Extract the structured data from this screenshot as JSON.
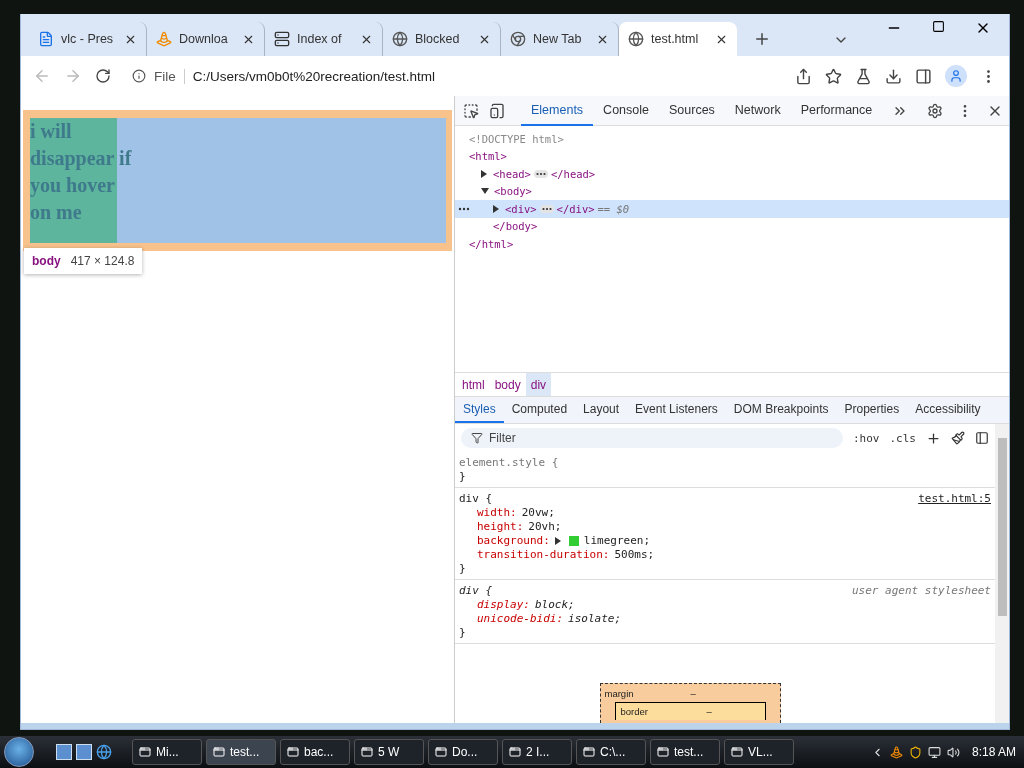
{
  "browser": {
    "tabs": [
      {
        "title": "vlc - Pres",
        "selected": false
      },
      {
        "title": "Downloa",
        "selected": false
      },
      {
        "title": "Index of",
        "selected": false
      },
      {
        "title": "Blocked",
        "selected": false
      },
      {
        "title": "New Tab",
        "selected": false
      },
      {
        "title": "test.html",
        "selected": true
      }
    ],
    "address": {
      "scheme": "File",
      "url": "C:/Users/vm0b0t%20recreation/test.html"
    }
  },
  "page": {
    "text": "i will disappear if you hover on me",
    "tooltip": {
      "tag": "body",
      "size": "417 × 124.8"
    }
  },
  "devtools": {
    "tabs": [
      {
        "label": "Elements",
        "selected": true
      },
      {
        "label": "Console",
        "selected": false
      },
      {
        "label": "Sources",
        "selected": false
      },
      {
        "label": "Network",
        "selected": false
      },
      {
        "label": "Performance",
        "selected": false
      }
    ],
    "dom_tree": [
      {
        "kind": "doctype",
        "text": "<!DOCTYPE html>"
      },
      {
        "kind": "element",
        "open": "<html>",
        "close": "</html>",
        "expanded": true,
        "selected": false,
        "children": [
          {
            "kind": "element",
            "open": "<head>",
            "close": "</head>",
            "expanded": false,
            "selected": false
          },
          {
            "kind": "element",
            "open": "<body>",
            "close": "</body>",
            "expanded": true,
            "selected": false,
            "children": [
              {
                "kind": "element",
                "open": "<div>",
                "close": "</div>",
                "expanded": false,
                "selected": true,
                "suffix": "== $0"
              }
            ]
          }
        ]
      }
    ],
    "breadcrumbs": [
      {
        "label": "html",
        "selected": false
      },
      {
        "label": "body",
        "selected": false
      },
      {
        "label": "div",
        "selected": true
      }
    ],
    "pane_tabs": [
      {
        "label": "Styles",
        "selected": true
      },
      {
        "label": "Computed",
        "selected": false
      },
      {
        "label": "Layout",
        "selected": false
      },
      {
        "label": "Event Listeners",
        "selected": false
      },
      {
        "label": "DOM Breakpoints",
        "selected": false
      },
      {
        "label": "Properties",
        "selected": false
      },
      {
        "label": "Accessibility",
        "selected": false
      }
    ],
    "filter": {
      "placeholder": "Filter"
    },
    "hov": ":hov",
    "cls": ".cls",
    "rules": [
      {
        "kind": "inline",
        "selector": "element.style {",
        "close": "}"
      },
      {
        "kind": "author",
        "selector": "div {",
        "source": "test.html:5",
        "close": "}",
        "properties": [
          {
            "name": "width:",
            "value": "20vw;"
          },
          {
            "name": "height:",
            "value": "20vh;"
          },
          {
            "name": "background:",
            "value": "limegreen;",
            "color": "#32cd32"
          },
          {
            "name": "transition-duration:",
            "value": "500ms;"
          }
        ]
      },
      {
        "kind": "user-agent",
        "selector": "div {",
        "source": "user agent stylesheet",
        "close": "}",
        "properties": [
          {
            "name": "display:",
            "value": "block;"
          },
          {
            "name": "unicode-bidi:",
            "value": "isolate;"
          }
        ]
      }
    ],
    "box_model": [
      {
        "label": "margin",
        "value": "–"
      },
      {
        "label": "border",
        "value": "–"
      }
    ]
  },
  "taskbar": {
    "items": [
      {
        "label": "Mi...",
        "selected": false
      },
      {
        "label": "test...",
        "selected": true
      },
      {
        "label": "bac...",
        "selected": false
      },
      {
        "label": "5 W",
        "selected": false
      },
      {
        "label": "Do...",
        "selected": false
      },
      {
        "label": "2 I...",
        "selected": false
      },
      {
        "label": "C:\\...",
        "selected": false
      },
      {
        "label": "test...",
        "selected": false
      },
      {
        "label": "VL...",
        "selected": false
      }
    ],
    "clock": "8:18 AM"
  }
}
